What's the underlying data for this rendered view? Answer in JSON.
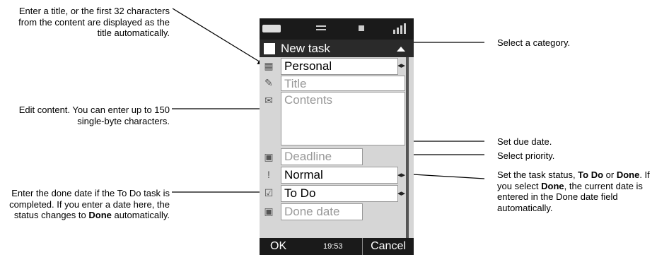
{
  "annotations": {
    "title_note": "Enter a title, or the first 32 characters from the content are displayed as the title automatically.",
    "content_note": "Edit content. You can enter up to 150 single-byte characters.",
    "done_note": {
      "before": "Enter the done date if the To Do task is completed. If you enter a date here, the status changes to ",
      "bold": "Done",
      "after": " automatically."
    },
    "category_note": "Select a category.",
    "due_note": "Set due date.",
    "priority_note": "Select priority.",
    "status_note": {
      "p1": "Set the task status, ",
      "b1": "To Do",
      "p2": " or ",
      "b2": "Done",
      "p3": ". If you select ",
      "b3": "Done",
      "p4": ", the current date is entered in the Done date field automatically."
    }
  },
  "phone": {
    "title": "New task",
    "category": "Personal",
    "title_placeholder": "Title",
    "contents_placeholder": "Contents",
    "deadline_placeholder": "Deadline",
    "priority": "Normal",
    "status": "To Do",
    "done_date_placeholder": "Done date",
    "softkey_left": "OK",
    "time": "19:53",
    "softkey_right": "Cancel"
  }
}
